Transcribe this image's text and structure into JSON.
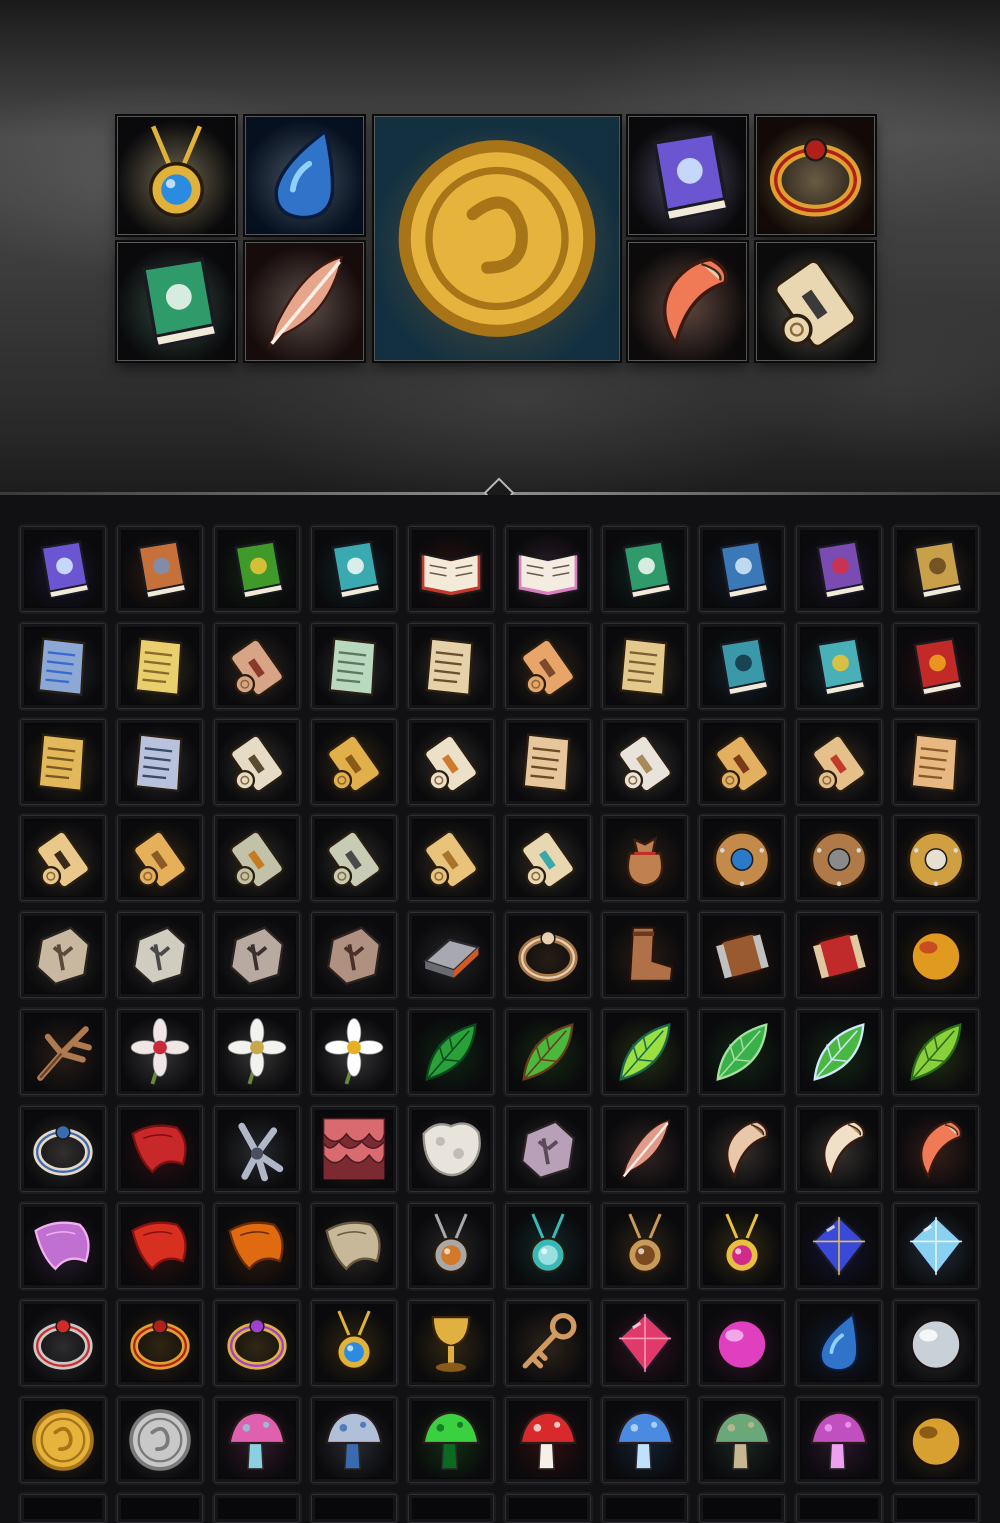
{
  "featured": [
    {
      "name": "amulet-blue-gem-icon",
      "bg": "#0a0a0c",
      "main": "#e0b23a",
      "accent": "#2a8be0",
      "shape": "amulet"
    },
    {
      "name": "water-drop-icon",
      "bg": "#06101e",
      "main": "#2f74c8",
      "accent": "#8fd0ff",
      "shape": "drop"
    },
    {
      "name": "gold-coin-large-icon",
      "bg": "#123040",
      "main": "#e6b33c",
      "accent": "#a77418",
      "shape": "coin"
    },
    {
      "name": "purple-spellbook-icon",
      "bg": "#0a0a0c",
      "main": "#6b55d0",
      "accent": "#cfe6ff",
      "shape": "book"
    },
    {
      "name": "gold-ring-icon",
      "bg": "#120a06",
      "main": "#e0a030",
      "accent": "#b0201a",
      "shape": "ring"
    },
    {
      "name": "green-leaf-book-icon",
      "bg": "#0a0a0c",
      "main": "#2f9a6a",
      "accent": "#e9f5ee",
      "shape": "book"
    },
    {
      "name": "feather-icon",
      "bg": "#170c0c",
      "main": "#e7a58c",
      "accent": "#fff0e6",
      "shape": "feather"
    },
    {
      "name": "claw-fang-icon",
      "bg": "#0c0a0a",
      "main": "#f07a55",
      "accent": "#e6cdb0",
      "shape": "fang"
    },
    {
      "name": "rolled-scroll-icon",
      "bg": "#0b0b0b",
      "main": "#e8d7b0",
      "accent": "#3a3a3a",
      "shape": "scroll"
    }
  ],
  "grid_rows": [
    [
      {
        "name": "purple-spellbook-icon",
        "main": "#6b55d0",
        "accent": "#cfe6ff",
        "shape": "book"
      },
      {
        "name": "leather-tome-icon",
        "main": "#c7713a",
        "accent": "#7a8fb2",
        "shape": "book"
      },
      {
        "name": "green-fleur-book-icon",
        "main": "#3f9a2a",
        "accent": "#e6c23a",
        "shape": "book"
      },
      {
        "name": "teal-book-icon",
        "main": "#3aaab0",
        "accent": "#e9f5f3",
        "shape": "book"
      },
      {
        "name": "open-red-book-icon",
        "main": "#c33a2c",
        "accent": "#f3ead9",
        "shape": "openbook"
      },
      {
        "name": "open-pink-book-icon",
        "main": "#d880c0",
        "accent": "#f4ece1",
        "shape": "openbook"
      },
      {
        "name": "green-leaf-book-icon",
        "main": "#2f9a6a",
        "accent": "#e9f5ee",
        "shape": "book"
      },
      {
        "name": "blue-rune-book-icon",
        "main": "#3a78b8",
        "accent": "#cfe3f6",
        "shape": "book"
      },
      {
        "name": "violet-gem-book-icon",
        "main": "#7a4bb0",
        "accent": "#d0304a",
        "shape": "book"
      },
      {
        "name": "golden-rune-book-icon",
        "main": "#c9a04a",
        "accent": "#6a4a20",
        "shape": "book"
      }
    ],
    [
      {
        "name": "magic-blue-scroll-icon",
        "main": "#8ea8d6",
        "accent": "#3a6ad0",
        "shape": "paper"
      },
      {
        "name": "gold-text-scroll-icon",
        "main": "#e9cf6e",
        "accent": "#8a6b2a",
        "shape": "paper"
      },
      {
        "name": "red-seal-scroll-icon",
        "main": "#d8a486",
        "accent": "#8a3a2a",
        "shape": "scroll"
      },
      {
        "name": "green-rune-scroll-icon",
        "main": "#b8d8c0",
        "accent": "#5a7a5a",
        "shape": "paper"
      },
      {
        "name": "parchment-writing-icon",
        "main": "#e6d2a8",
        "accent": "#6a5030",
        "shape": "paper"
      },
      {
        "name": "quill-scroll-icon",
        "main": "#e8a56a",
        "accent": "#7a4a2a",
        "shape": "scroll"
      },
      {
        "name": "leaf-note-icon",
        "main": "#e3c98c",
        "accent": "#7a6030",
        "shape": "paper"
      },
      {
        "name": "teal-letter-book-icon",
        "main": "#3a98a8",
        "accent": "#153a48",
        "shape": "book"
      },
      {
        "name": "star-emblem-book-icon",
        "main": "#4ab0b8",
        "accent": "#e6c23a",
        "shape": "book"
      },
      {
        "name": "red-swirl-book-icon",
        "main": "#c22a28",
        "accent": "#f0a020",
        "shape": "book"
      }
    ],
    [
      {
        "name": "golden-parchment-icon",
        "main": "#e3b85a",
        "accent": "#7a5a20",
        "shape": "paper"
      },
      {
        "name": "blue-letter-icon",
        "main": "#b8c2dc",
        "accent": "#3a4a6a",
        "shape": "paper"
      },
      {
        "name": "ancient-script-icon",
        "main": "#e6dcc6",
        "accent": "#5a4a30",
        "shape": "scroll"
      },
      {
        "name": "spiral-scroll-icon",
        "main": "#e2b04a",
        "accent": "#8a5a1a",
        "shape": "scroll"
      },
      {
        "name": "small-scroll-icon",
        "main": "#ece0c8",
        "accent": "#d07a30",
        "shape": "scroll"
      },
      {
        "name": "torn-parchment-icon",
        "main": "#e6c69a",
        "accent": "#6a4a2a",
        "shape": "paper"
      },
      {
        "name": "white-roll-icon",
        "main": "#e8e4dc",
        "accent": "#a88a5a",
        "shape": "scroll"
      },
      {
        "name": "tied-scroll-icon",
        "main": "#e3b060",
        "accent": "#7a3a1a",
        "shape": "scroll"
      },
      {
        "name": "ribbon-scroll-icon",
        "main": "#e6c08a",
        "accent": "#c33a2a",
        "shape": "scroll"
      },
      {
        "name": "curled-parchment-icon",
        "main": "#e8b882",
        "accent": "#8a5a2a",
        "shape": "paper"
      }
    ],
    [
      {
        "name": "skull-seal-scroll-icon",
        "main": "#eac88a",
        "accent": "#3a2a1a",
        "shape": "scroll"
      },
      {
        "name": "leather-tie-scroll-icon",
        "main": "#e6b05a",
        "accent": "#8a5a2a",
        "shape": "scroll"
      },
      {
        "name": "gray-seal-scroll-icon",
        "main": "#c2c2a8",
        "accent": "#c87a20",
        "shape": "scroll"
      },
      {
        "name": "bound-scroll-icon",
        "main": "#c8ccb4",
        "accent": "#4a4a4a",
        "shape": "scroll"
      },
      {
        "name": "long-scroll-icon",
        "main": "#eac37a",
        "accent": "#a8742a",
        "shape": "scroll"
      },
      {
        "name": "gem-clasp-scroll-icon",
        "main": "#e8d7b0",
        "accent": "#3aa8a8",
        "shape": "scroll"
      },
      {
        "name": "coin-pouch-icon",
        "main": "#c08050",
        "accent": "#c0302a",
        "shape": "pouch"
      },
      {
        "name": "blue-star-shield-icon",
        "main": "#c48a4a",
        "accent": "#2a7ac8",
        "shape": "shield"
      },
      {
        "name": "wooden-round-shield-icon",
        "main": "#b07a48",
        "accent": "#8a8a8a",
        "shape": "shield"
      },
      {
        "name": "skull-shield-icon",
        "main": "#d0a040",
        "accent": "#e6e0d0",
        "shape": "shield"
      }
    ],
    [
      {
        "name": "rune-stone-icon",
        "main": "#c8b8a0",
        "accent": "#5a4a3a",
        "shape": "stone"
      },
      {
        "name": "algiz-rune-stone-icon",
        "main": "#d0ccc0",
        "accent": "#4a4a4a",
        "shape": "stone"
      },
      {
        "name": "rune-tablets-icon",
        "main": "#b8aaa0",
        "accent": "#3a3030",
        "shape": "stone"
      },
      {
        "name": "skull-card-icon",
        "main": "#b09080",
        "accent": "#4a3028",
        "shape": "stone"
      },
      {
        "name": "iron-ingot-icon",
        "main": "#a8a8b0",
        "accent": "#d05a20",
        "shape": "ingot"
      },
      {
        "name": "bone-ring-icon",
        "main": "#a8784a",
        "accent": "#e8d0b0",
        "shape": "ring"
      },
      {
        "name": "leather-boots-icon",
        "main": "#b07048",
        "accent": "#6a3a20",
        "shape": "boot"
      },
      {
        "name": "leather-bracer-icon",
        "main": "#9a5a30",
        "accent": "#c0c0c0",
        "shape": "bracer"
      },
      {
        "name": "red-cuff-icon",
        "main": "#c02a2a",
        "accent": "#e0c8a0",
        "shape": "bracer"
      },
      {
        "name": "feathered-orb-icon",
        "main": "#e09a20",
        "accent": "#c03a20",
        "shape": "orb"
      }
    ],
    [
      {
        "name": "dry-root-icon",
        "main": "#b07a50",
        "accent": "#6a4028",
        "shape": "branch"
      },
      {
        "name": "white-flower-icon",
        "main": "#f0e6e6",
        "accent": "#c82a3a",
        "shape": "flower"
      },
      {
        "name": "cotton-plant-icon",
        "main": "#f2f2ee",
        "accent": "#c8a848",
        "shape": "flower"
      },
      {
        "name": "chamomile-icon",
        "main": "#ffffff",
        "accent": "#e8b020",
        "shape": "flower"
      },
      {
        "name": "palm-leaf-icon",
        "main": "#2aa03a",
        "accent": "#0a4a1a",
        "shape": "leaf"
      },
      {
        "name": "broad-leaves-icon",
        "main": "#4ab83a",
        "accent": "#6a3a1a",
        "shape": "leaf"
      },
      {
        "name": "glowing-leaves-icon",
        "main": "#9ae040",
        "accent": "#1a6a50",
        "shape": "leaf"
      },
      {
        "name": "fern-leaves-icon",
        "main": "#3ab04a",
        "accent": "#a8e0a0",
        "shape": "leaf"
      },
      {
        "name": "lily-pad-icon",
        "main": "#4ab840",
        "accent": "#d0e8ff",
        "shape": "leaf"
      },
      {
        "name": "serrated-leaf-icon",
        "main": "#8ad03a",
        "accent": "#2a6a1a",
        "shape": "leaf"
      }
    ],
    [
      {
        "name": "cloth-belt-icon",
        "main": "#e8d8c8",
        "accent": "#3a6ab0",
        "shape": "ring"
      },
      {
        "name": "red-bandana-icon",
        "main": "#c8282a",
        "accent": "#7a1010",
        "shape": "cloth"
      },
      {
        "name": "bird-claw-icon",
        "main": "#b0b8c8",
        "accent": "#4a5060",
        "shape": "claw"
      },
      {
        "name": "red-scales-icon",
        "main": "#d86a70",
        "accent": "#7a2a30",
        "shape": "scales"
      },
      {
        "name": "white-fur-icon",
        "main": "#e8e4dc",
        "accent": "#9a968e",
        "shape": "fur"
      },
      {
        "name": "crystal-scale-icon",
        "main": "#b8a0b8",
        "accent": "#5a4a5a",
        "shape": "stone"
      },
      {
        "name": "pink-feather-icon",
        "main": "#e09a8a",
        "accent": "#fff0e6",
        "shape": "feather"
      },
      {
        "name": "bone-horn-icon",
        "main": "#e8c8a8",
        "accent": "#8a6a4a",
        "shape": "fang"
      },
      {
        "name": "curved-tusk-icon",
        "main": "#f0e0c8",
        "accent": "#c88a5a",
        "shape": "fang"
      },
      {
        "name": "red-fang-icon",
        "main": "#f07a55",
        "accent": "#e6cdb0",
        "shape": "fang"
      }
    ],
    [
      {
        "name": "pink-silk-icon",
        "main": "#c070d0",
        "accent": "#f0b0f0",
        "shape": "cloth"
      },
      {
        "name": "red-cloth-roll-icon",
        "main": "#d83020",
        "accent": "#8a1010",
        "shape": "cloth"
      },
      {
        "name": "lava-pelt-icon",
        "main": "#e06a10",
        "accent": "#6a2a08",
        "shape": "cloth"
      },
      {
        "name": "burlap-cloth-icon",
        "main": "#c8b89a",
        "accent": "#6a5a40",
        "shape": "cloth"
      },
      {
        "name": "compass-pendant-icon",
        "main": "#a8a8a8",
        "accent": "#d07a2a",
        "shape": "amulet"
      },
      {
        "name": "triangle-pendant-icon",
        "main": "#3ab8b8",
        "accent": "#9ae0e0",
        "shape": "amulet"
      },
      {
        "name": "feather-charm-icon",
        "main": "#c89a5a",
        "accent": "#7a4a20",
        "shape": "amulet"
      },
      {
        "name": "lotus-amulet-icon",
        "main": "#e8c040",
        "accent": "#d02a8a",
        "shape": "amulet"
      },
      {
        "name": "blue-crystal-tile-icon",
        "main": "#3a4ad8",
        "accent": "#e6c040",
        "shape": "gem"
      },
      {
        "name": "ice-crystal-icon",
        "main": "#8ad0f0",
        "accent": "#e8f8ff",
        "shape": "gem"
      }
    ],
    [
      {
        "name": "ruby-ring-icon",
        "main": "#c8c8c8",
        "accent": "#d02a2a",
        "shape": "ring"
      },
      {
        "name": "gold-ring-icon",
        "main": "#e0a030",
        "accent": "#b0201a",
        "shape": "ring"
      },
      {
        "name": "amethyst-ring-icon",
        "main": "#e0b040",
        "accent": "#a040d0",
        "shape": "ring"
      },
      {
        "name": "amulet-blue-gem-icon",
        "main": "#e0b23a",
        "accent": "#2a8be0",
        "shape": "amulet"
      },
      {
        "name": "golden-chalice-icon",
        "main": "#e0b040",
        "accent": "#8a5a1a",
        "shape": "chalice"
      },
      {
        "name": "old-key-icon",
        "main": "#d09a60",
        "accent": "#7a4a20",
        "shape": "key"
      },
      {
        "name": "ruby-gem-icon",
        "main": "#e03a6a",
        "accent": "#ff9ab8",
        "shape": "gem"
      },
      {
        "name": "crystal-ball-icon",
        "main": "#e040c0",
        "accent": "#f8c0f0",
        "shape": "orb"
      },
      {
        "name": "water-drop-icon",
        "main": "#2f74c8",
        "accent": "#8fd0ff",
        "shape": "drop"
      },
      {
        "name": "pearl-icon",
        "main": "#c8d0d8",
        "accent": "#ffffff",
        "shape": "orb"
      }
    ],
    [
      {
        "name": "gold-coin-icon",
        "main": "#e6b33c",
        "accent": "#a77418",
        "shape": "coin"
      },
      {
        "name": "silver-coins-icon",
        "main": "#c8c8c8",
        "accent": "#7a7a7a",
        "shape": "coin"
      },
      {
        "name": "pink-mushroom-icon",
        "main": "#e060b0",
        "accent": "#8ad0e0",
        "shape": "mushroom"
      },
      {
        "name": "blue-mushrooms-icon",
        "main": "#b0c0d8",
        "accent": "#3a6ab0",
        "shape": "mushroom"
      },
      {
        "name": "green-glow-fungus-icon",
        "main": "#3ad040",
        "accent": "#0a6a20",
        "shape": "mushroom"
      },
      {
        "name": "fly-agaric-icon",
        "main": "#d82a2a",
        "accent": "#f8f0e8",
        "shape": "mushroom"
      },
      {
        "name": "blue-funnel-mushroom-icon",
        "main": "#4a8ae0",
        "accent": "#c0e0ff",
        "shape": "mushroom"
      },
      {
        "name": "green-cap-mushroom-icon",
        "main": "#6aa87a",
        "accent": "#c8b890",
        "shape": "mushroom"
      },
      {
        "name": "violet-mushrooms-icon",
        "main": "#c050c0",
        "accent": "#f0a0f0",
        "shape": "mushroom"
      },
      {
        "name": "golden-egg-charm-icon",
        "main": "#d8a030",
        "accent": "#7a4a10",
        "shape": "orb"
      }
    ]
  ]
}
